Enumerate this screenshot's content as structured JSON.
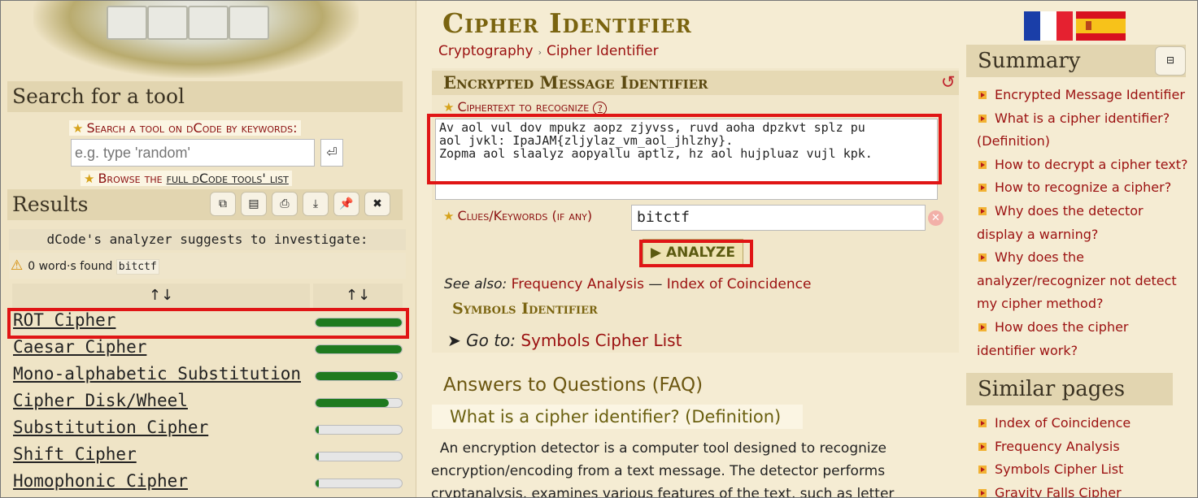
{
  "left": {
    "search_title": "Search for a tool",
    "search_label": "Search a tool on dCode by keywords:",
    "search_placeholder": "e.g. type 'random'",
    "browse_prefix": "Browse the ",
    "browse_link": "full dCode tools' list",
    "results_title": "Results",
    "suggest_text": "dCode's analyzer suggests to investigate:",
    "found_text": "0 word·s found",
    "found_token": "bitctf",
    "sort_icon": "↑↓",
    "results": [
      {
        "name": "ROT Cipher",
        "score": 1.0
      },
      {
        "name": "Caesar Cipher",
        "score": 1.0
      },
      {
        "name": "Mono-alphabetic Substitution",
        "score": 0.95
      },
      {
        "name": "Cipher Disk/Wheel",
        "score": 0.85
      },
      {
        "name": "Substitution Cipher",
        "score": 0.04
      },
      {
        "name": "Shift Cipher",
        "score": 0.04
      },
      {
        "name": "Homophonic Cipher",
        "score": 0.04
      }
    ]
  },
  "main": {
    "title": "Cipher Identifier",
    "breadcrumb": [
      "Cryptography",
      "Cipher Identifier"
    ],
    "panel_title": "Encrypted Message Identifier",
    "ciphertext_label": "Ciphertext to recognize",
    "help_icon": "?",
    "ciphertext": "Av aol vul dov mpukz aopz zjyvss, ruvd aoha dpzkvt splz pu\naol jvkl: IpaJAM{zljylaz_vm_aol_jhlzhy}.\nZopma aol slaalyz aopyallu aptlz, hz aol hujpluaz vujl kpk.",
    "clues_label": "Clues/Keywords (if any)",
    "clues_value": "bitctf",
    "analyze_label": "▶ ANALYZE",
    "see_also_label": "See also:",
    "see_also_1": "Frequency Analysis",
    "see_also_sep": " — ",
    "see_also_2": "Index of Coincidence",
    "symbols_title": "Symbols Identifier",
    "goto_label": "Go to:",
    "goto_link": "Symbols Cipher List",
    "faq_title": "Answers to Questions (FAQ)",
    "faq_q1": "What is a cipher identifier? (Definition)",
    "faq_a1": "An encryption detector is a computer tool designed to recognize encryption/encoding from a text message. The detector performs cryptanalysis, examines various features of the text, such as letter"
  },
  "right": {
    "summary_title": "Summary",
    "collapse_icon": "⊟",
    "summary_items": [
      "Encrypted Message Identifier",
      "What is a cipher identifier? (Definition)",
      "How to decrypt a cipher text?",
      "How to recognize a cipher?",
      "Why does the detector display a warning?",
      "Why does the analyzer/recognizer not detect my cipher method?",
      "How does the cipher identifier work?"
    ],
    "similar_title": "Similar pages",
    "similar_items": [
      "Index of Coincidence",
      "Frequency Analysis",
      "Symbols Cipher List",
      "Gravity Falls Cipher"
    ]
  },
  "colors": {
    "link": "#9b1010",
    "bar_fill": "#1f7a1f",
    "highlight": "#e01515"
  }
}
